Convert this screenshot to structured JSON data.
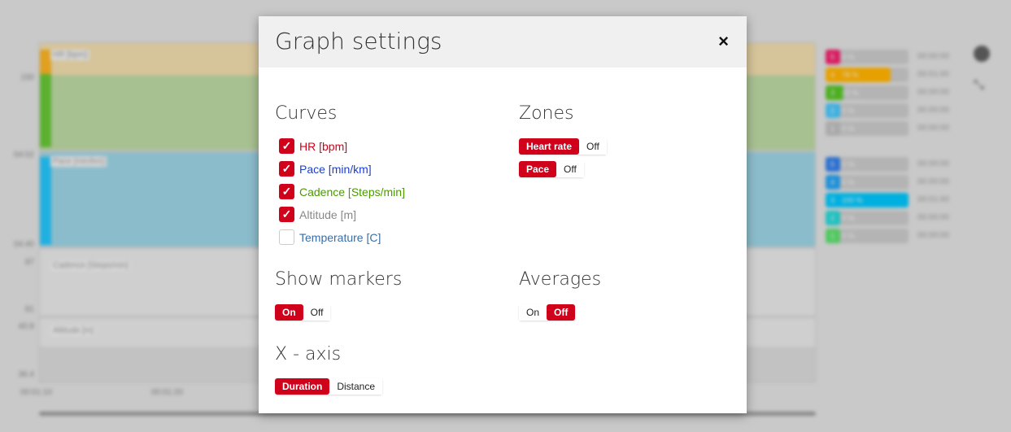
{
  "background": {
    "plots": [
      {
        "title": "HR [bpm]",
        "ylabels": [
          "150"
        ]
      },
      {
        "title": "Pace [min/km]",
        "ylabels": [
          "04:02",
          "04:40"
        ]
      },
      {
        "title": "Cadence [Steps/min]",
        "ylabels": [
          "87",
          "81"
        ]
      },
      {
        "title": "Altitude [m]",
        "ylabels": [
          "40.8",
          "36.4"
        ]
      }
    ],
    "xlabels": [
      "00:01:10",
      "00:01:20"
    ],
    "hr_zones": [
      {
        "n": "5",
        "pct": "0 %",
        "pct_value": 0,
        "time": "00:00:00",
        "color": "#d81b60"
      },
      {
        "n": "4",
        "pct": "78 %",
        "pct_value": 78,
        "time": "00:01:00",
        "color": "#e6a000"
      },
      {
        "n": "3",
        "pct": "22 %",
        "pct_value": 22,
        "time": "00:00:00",
        "color": "#4caf20"
      },
      {
        "n": "2",
        "pct": "0 %",
        "pct_value": 0,
        "time": "00:00:00",
        "color": "#3fb0e0"
      },
      {
        "n": "1",
        "pct": "0 %",
        "pct_value": 0,
        "time": "00:00:00",
        "color": "#aaaaaa"
      }
    ],
    "pace_zones": [
      {
        "n": "5",
        "pct": "0 %",
        "pct_value": 0,
        "time": "00:00:00",
        "color": "#2a70d0"
      },
      {
        "n": "4",
        "pct": "0 %",
        "pct_value": 0,
        "time": "00:00:00",
        "color": "#2090d8"
      },
      {
        "n": "3",
        "pct": "100 %",
        "pct_value": 100,
        "time": "00:01:00",
        "color": "#00b0e0"
      },
      {
        "n": "2",
        "pct": "0 %",
        "pct_value": 0,
        "time": "00:00:00",
        "color": "#20c0c0"
      },
      {
        "n": "1",
        "pct": "0 %",
        "pct_value": 0,
        "time": "00:00:00",
        "color": "#50c860"
      }
    ]
  },
  "modal": {
    "title": "Graph settings",
    "close": "×",
    "curves": {
      "heading": "Curves",
      "items": [
        {
          "label": "HR [bpm]",
          "checked": true,
          "color": "#d0021b"
        },
        {
          "label": "Pace [min/km]",
          "checked": true,
          "color": "#1a3fd0"
        },
        {
          "label": "Cadence [Steps/min]",
          "checked": true,
          "color": "#4a9a00"
        },
        {
          "label": "Altitude [m]",
          "checked": true,
          "color": "#888888"
        },
        {
          "label": "Temperature [C]",
          "checked": false,
          "color": "#3a6ea5"
        }
      ]
    },
    "zones": {
      "heading": "Zones",
      "hr": {
        "on": "Heart rate",
        "off": "Off",
        "active": "on"
      },
      "pace": {
        "on": "Pace",
        "off": "Off",
        "active": "on"
      }
    },
    "markers": {
      "heading": "Show markers",
      "on": "On",
      "off": "Off",
      "active": "on"
    },
    "averages": {
      "heading": "Averages",
      "on": "On",
      "off": "Off",
      "active": "off"
    },
    "xaxis": {
      "heading": "X - axis",
      "a": "Duration",
      "b": "Distance",
      "active": "a"
    },
    "check_glyph": "✓",
    "accent": "#d0021b"
  }
}
